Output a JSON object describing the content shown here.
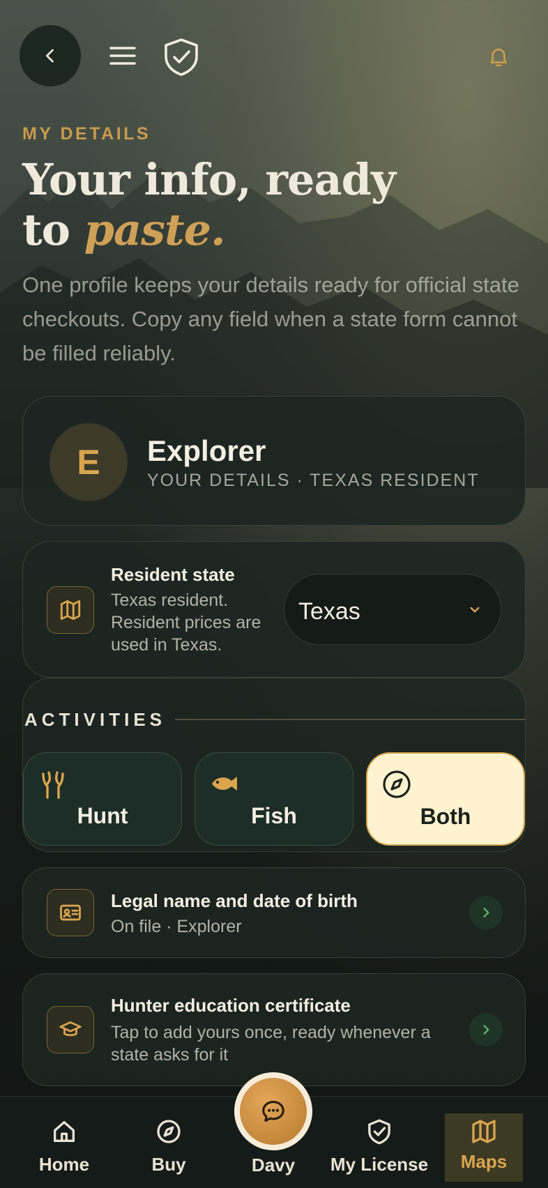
{
  "header": {
    "back_icon": "chevron-left-icon",
    "menu_icon": "hamburger-menu-icon",
    "logo_icon": "shield-check-icon",
    "bell_icon": "bell-icon"
  },
  "hero": {
    "eyebrow": "MY DETAILS",
    "headline_line1": "Your info, ready",
    "headline_line2_plain": "to",
    "headline_line2_accent": "paste.",
    "intro": "One profile keeps your details ready for official state checkouts. Copy any field when a state form cannot be filled reliably."
  },
  "profile": {
    "avatar_initial": "E",
    "name": "Explorer",
    "subtitle": "YOUR DETAILS · TEXAS RESIDENT"
  },
  "resident": {
    "icon": "map-icon",
    "title": "Resident state",
    "description": "Texas resident. Resident prices are used in Texas.",
    "selected_state": "Texas"
  },
  "activities": {
    "label": "ACTIVITIES",
    "options": [
      {
        "label": "Hunt",
        "icon": "antler-icon",
        "selected": false
      },
      {
        "label": "Fish",
        "icon": "fish-icon",
        "selected": false
      },
      {
        "label": "Both",
        "icon": "compass-icon",
        "selected": true
      }
    ]
  },
  "rows": [
    {
      "title": "Legal name and date of birth",
      "description": "On file · Explorer",
      "icon": "id-card-icon"
    },
    {
      "title": "Hunter education certificate",
      "description": "Tap to add yours once, ready whenever a state asks for it",
      "icon": "graduation-cap-icon"
    }
  ],
  "nav": {
    "items": [
      {
        "label": "Home",
        "icon": "home-icon"
      },
      {
        "label": "Buy",
        "icon": "compass-icon"
      },
      {
        "label": "Davy",
        "icon": "chat-icon"
      },
      {
        "label": "My License",
        "icon": "shield-check-icon"
      },
      {
        "label": "Maps",
        "icon": "map-icon",
        "active": true
      }
    ]
  },
  "colors": {
    "accent_gold": "#c89b4e",
    "selected_bg": "#fff3cf",
    "card_bg": "#1d2521",
    "page_bg": "#151b18"
  }
}
